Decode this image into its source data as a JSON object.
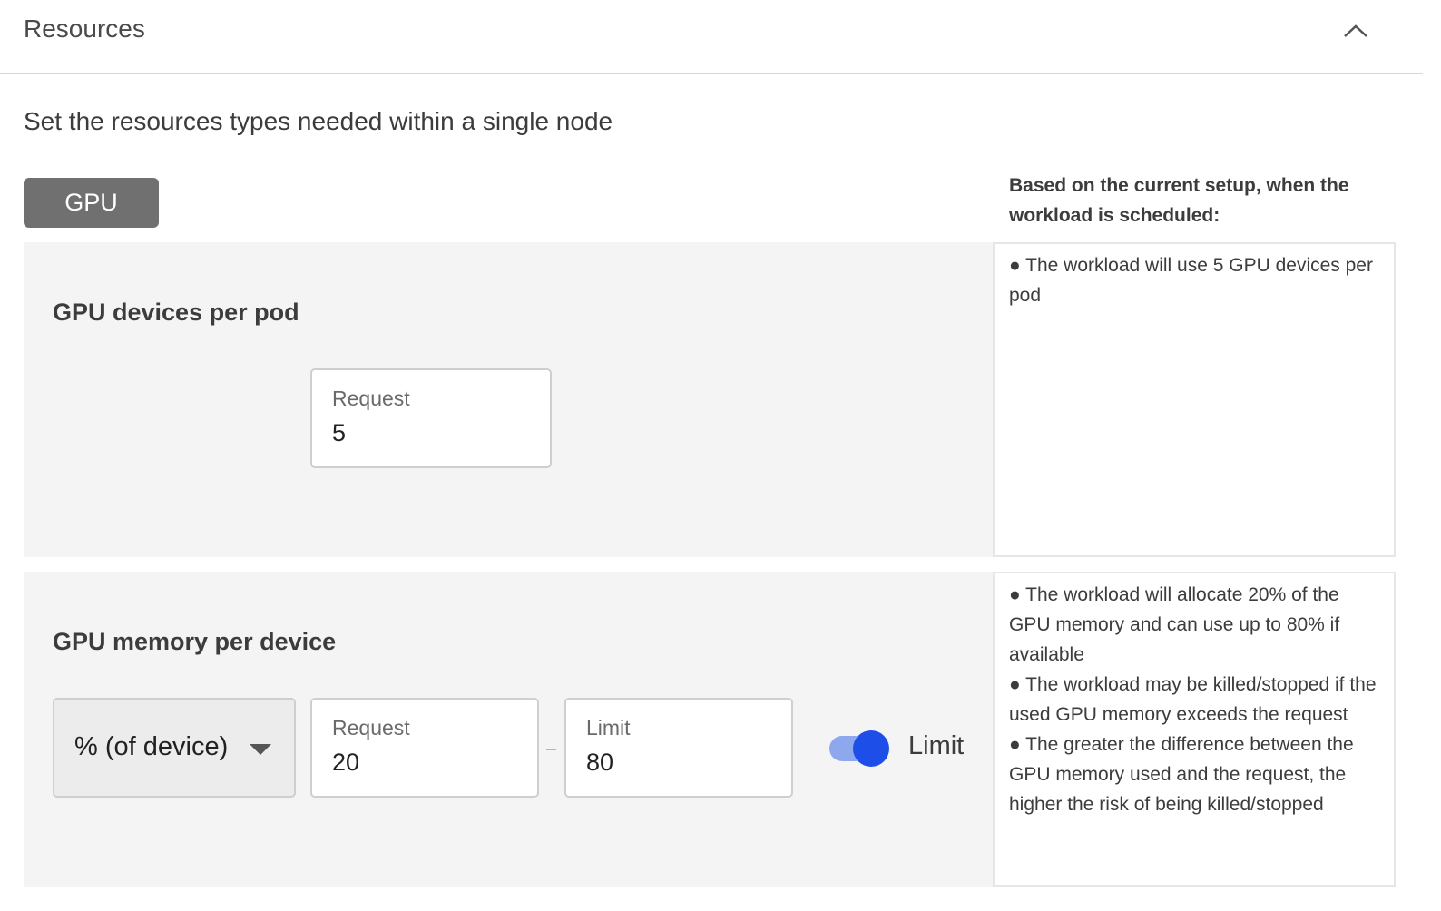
{
  "header": {
    "title": "Resources",
    "collapse_icon": "chevron-up-icon"
  },
  "subtitle": "Set the resources types needed within a single node",
  "tabs": [
    {
      "label": "GPU",
      "selected": true
    }
  ],
  "summary": {
    "heading": "Based on the current setup, when the workload is scheduled:"
  },
  "gpu_devices": {
    "title": "GPU devices per pod",
    "request_label": "Request",
    "request_value": "5",
    "info": [
      "● The workload will use 5 GPU devices per pod"
    ]
  },
  "gpu_memory": {
    "title": "GPU memory per device",
    "unit_select": "% (of device)",
    "request_label": "Request",
    "request_value": "20",
    "separator": "–",
    "limit_label": "Limit",
    "limit_value": "80",
    "limit_toggle_label": "Limit",
    "limit_toggle_on": true,
    "info": [
      "● The workload will allocate 20% of the GPU memory and can use up to 80% if available",
      "● The workload may be killed/stopped if the used GPU memory exceeds the request",
      "● The greater the difference between the GPU memory used and the request, the higher the risk of being killed/stopped"
    ]
  },
  "colors": {
    "accent": "#1e4ee8",
    "toggle_track": "#8ea8ee",
    "tab_bg": "#707070",
    "section_bg": "#f4f4f4"
  }
}
